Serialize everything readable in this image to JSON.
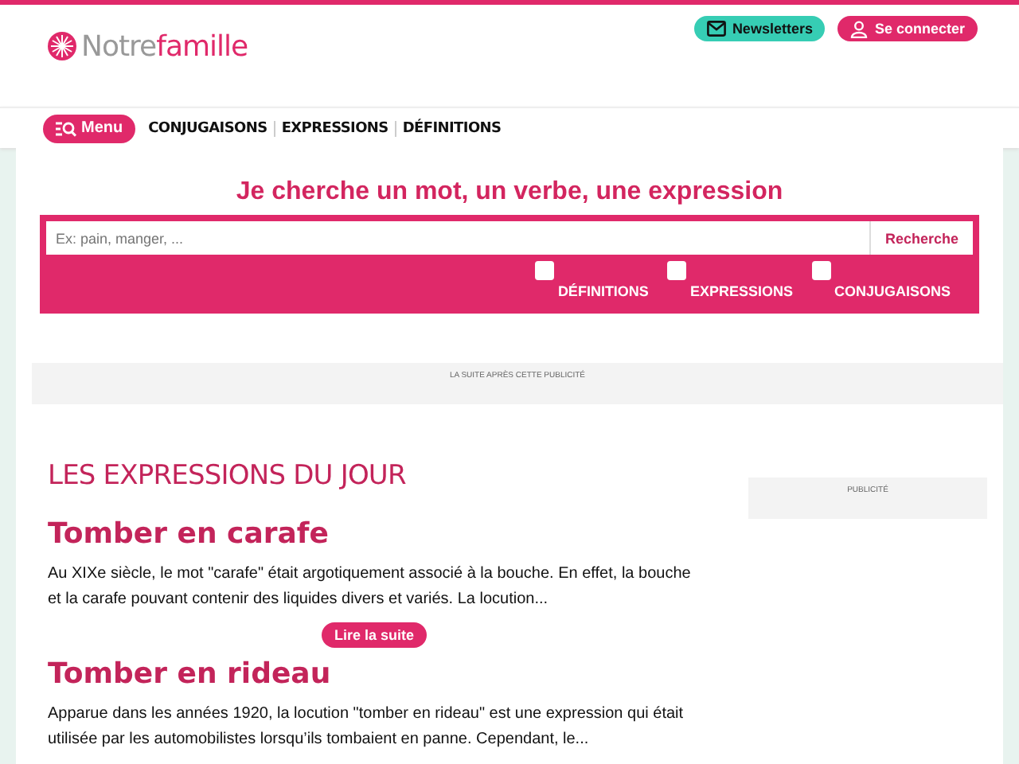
{
  "logo": {
    "text_1": "Notre",
    "text_2": "famille"
  },
  "header_buttons": [
    {
      "kind": "newsletter",
      "label": "Newsletters"
    },
    {
      "kind": "login",
      "label": "Se connecter"
    }
  ],
  "nav": {
    "menu_button": "Menu",
    "links": [
      "CONJUGAISONS",
      "EXPRESSIONS",
      "DÉFINITIONS"
    ]
  },
  "search": {
    "title": "Je cherche un mot, un verbe, une expression",
    "placeholder": "Ex: pain, manger, ...",
    "button": "Recherche",
    "filters": [
      {
        "label": "DÉFINITIONS",
        "checked": false
      },
      {
        "label": "EXPRESSIONS",
        "checked": false
      },
      {
        "label": "CONJUGAISONS",
        "checked": false
      }
    ]
  },
  "ad_banner": "LA SUITE APRÈS CETTE PUBLICITÉ",
  "section_title": "LES EXPRESSIONS DU JOUR",
  "articles": [
    {
      "title": "Tomber en carafe",
      "excerpt": "Au XIXe siècle, le mot \"carafe\" était argotiquement associé à la bouche. En effet, la bouche et la carafe pouvant contenir des liquides divers et variés. La locution...",
      "button": "Lire la suite"
    },
    {
      "title": "Tomber en rideau",
      "excerpt": "Apparue dans les années 1920, la locution \"tomber en rideau\" est une expression qui était utilisée par les automobilistes lorsqu’ils tombaient en panne. Cependant, le..."
    }
  ],
  "sidebar_ad": "PUBLICITÉ"
}
